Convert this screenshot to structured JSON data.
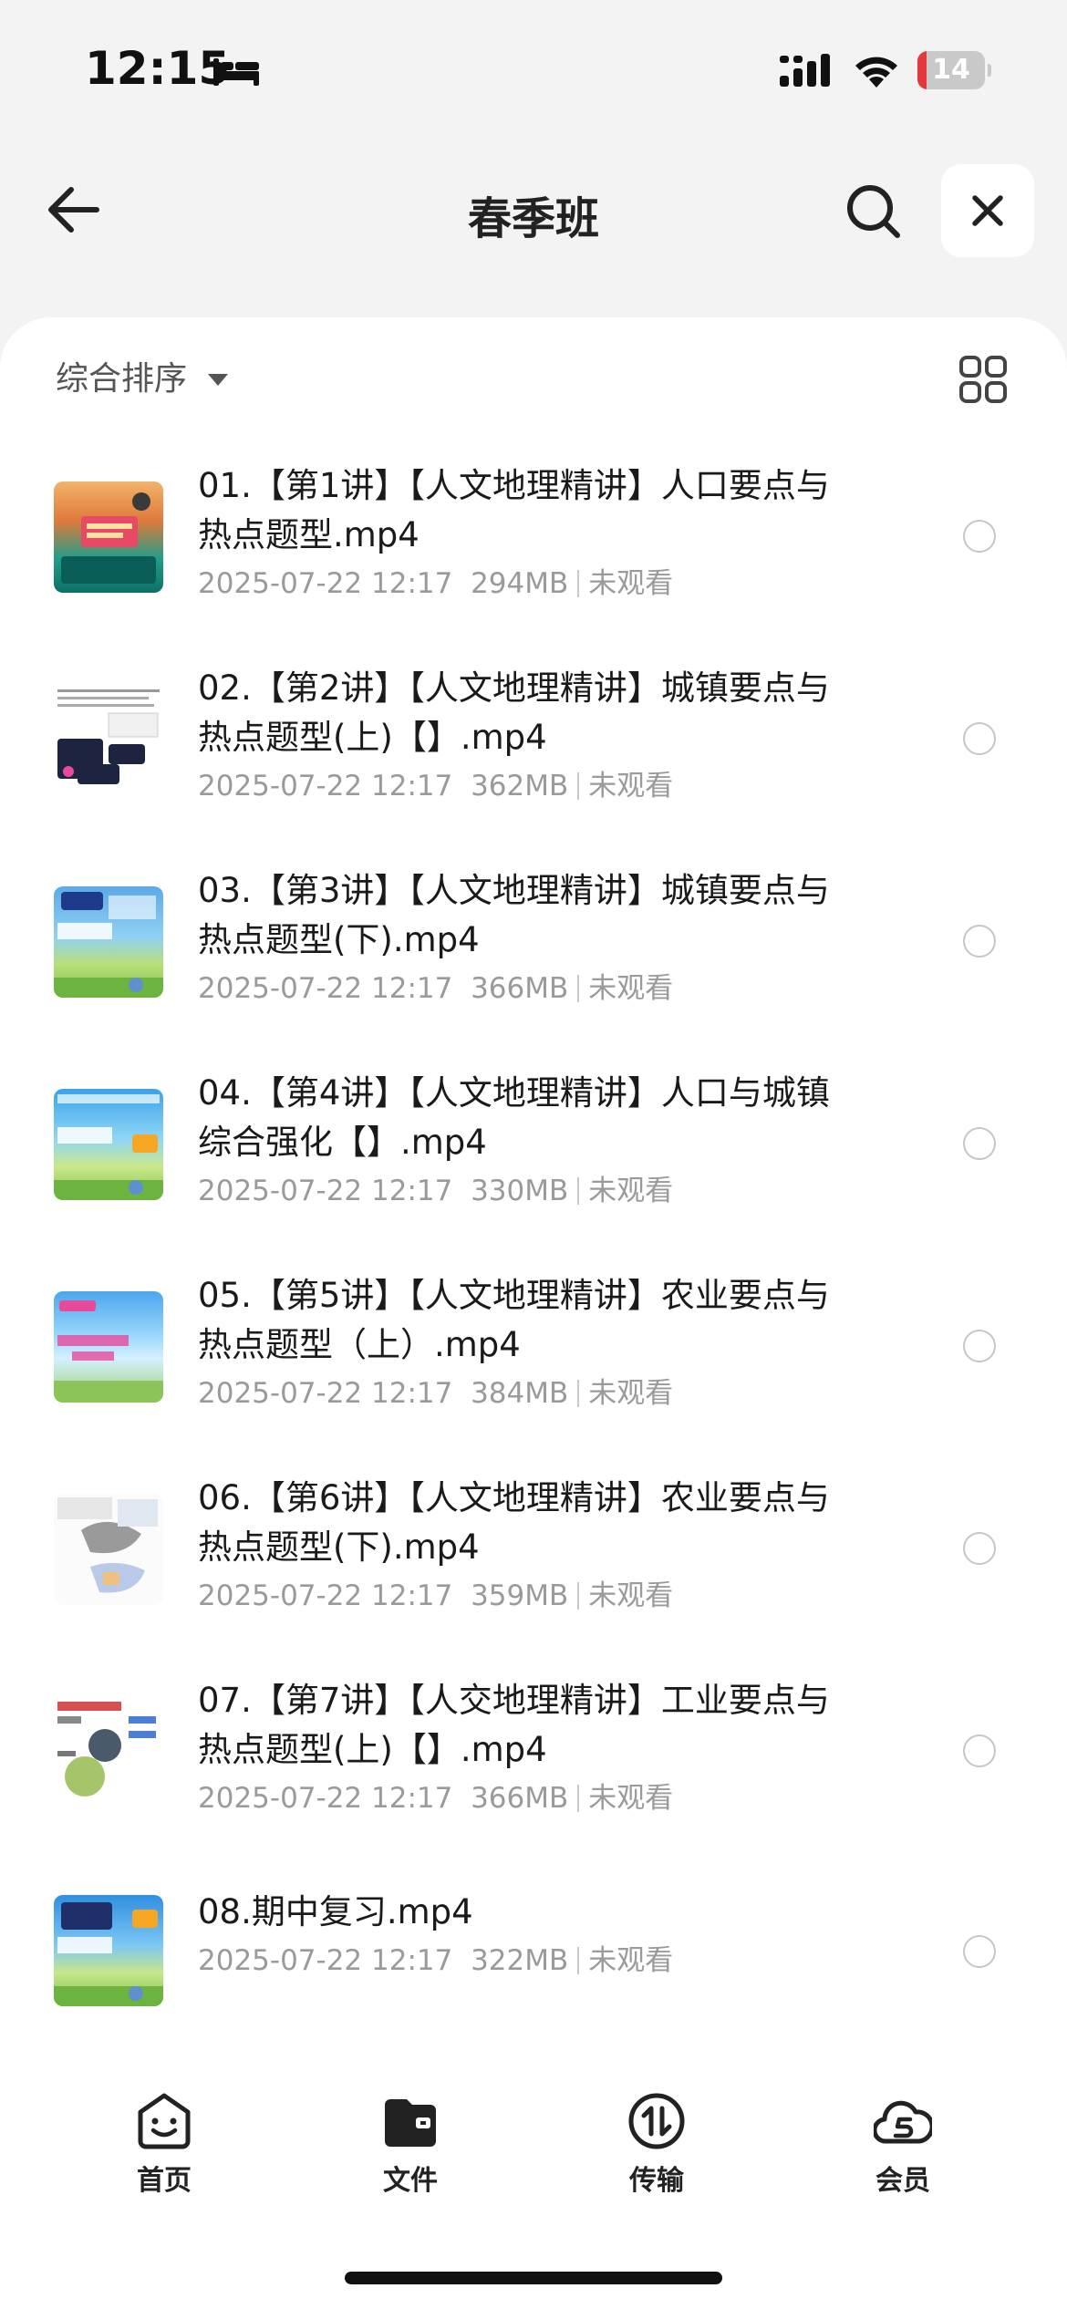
{
  "status_bar": {
    "time": "12:15",
    "battery_level": "14",
    "battery_fraction": 0.14,
    "battery_color": "#e5383b"
  },
  "nav": {
    "title": "春季班"
  },
  "sort": {
    "label": "综合排序"
  },
  "files": [
    {
      "title": "01.【第1讲】【人文地理精讲】人口要点与热点题型.mp4",
      "date": "2025-07-22 12:17",
      "size": "294MB",
      "status": "未观看"
    },
    {
      "title": "02.【第2讲】【人文地理精讲】城镇要点与热点题型(上)【】.mp4",
      "date": "2025-07-22 12:17",
      "size": "362MB",
      "status": "未观看"
    },
    {
      "title": "03.【第3讲】【人文地理精讲】城镇要点与热点题型(下).mp4",
      "date": "2025-07-22 12:17",
      "size": "366MB",
      "status": "未观看"
    },
    {
      "title": "04.【第4讲】【人文地理精讲】人口与城镇综合强化【】.mp4",
      "date": "2025-07-22 12:17",
      "size": "330MB",
      "status": "未观看"
    },
    {
      "title": "05.【第5讲】【人文地理精讲】农业要点与热点题型（上）.mp4",
      "date": "2025-07-22 12:17",
      "size": "384MB",
      "status": "未观看"
    },
    {
      "title": "06.【第6讲】【人文地理精讲】农业要点与热点题型(下).mp4",
      "date": "2025-07-22 12:17",
      "size": "359MB",
      "status": "未观看"
    },
    {
      "title": "07.【第7讲】【人交地理精讲】工业要点与热点题型(上)【】.mp4",
      "date": "2025-07-22 12:17",
      "size": "366MB",
      "status": "未观看"
    },
    {
      "title": "08.期中复习.mp4",
      "date": "2025-07-22 12:17",
      "size": "322MB",
      "status": "未观看"
    }
  ],
  "tabs": [
    {
      "label": "首页",
      "icon": "smile-face-icon"
    },
    {
      "label": "文件",
      "icon": "folder-icon"
    },
    {
      "label": "传输",
      "icon": "transfer-icon"
    },
    {
      "label": "会员",
      "icon": "cloud-member-icon"
    }
  ]
}
